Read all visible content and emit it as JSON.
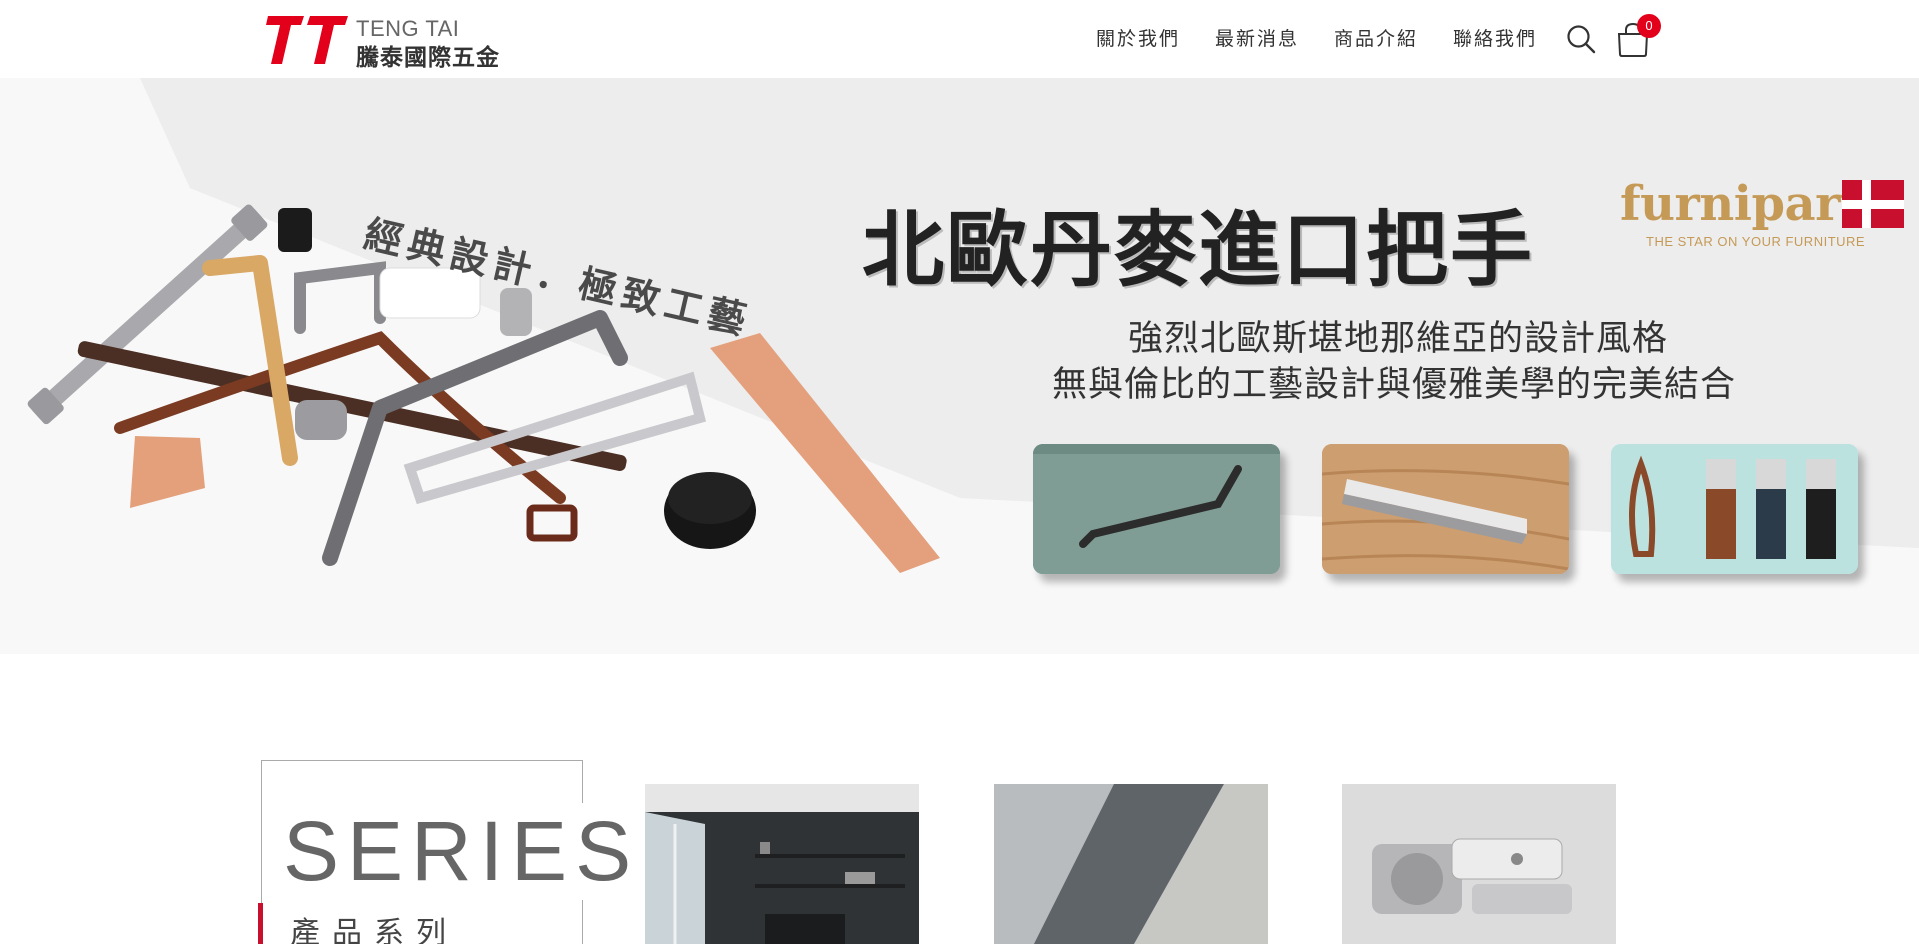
{
  "header": {
    "logo": {
      "mark": "TT",
      "en": "TENG TAI",
      "zh": "騰泰國際五金"
    },
    "nav": [
      {
        "label": "關於我們"
      },
      {
        "label": "最新消息"
      },
      {
        "label": "商品介紹"
      },
      {
        "label": "聯絡我們"
      }
    ],
    "icons": {
      "search": "search-icon",
      "cart": "shopping-bag-icon"
    },
    "cart_count": "0",
    "accent_color": "#e2001a"
  },
  "banner": {
    "slogan": "經典設計．極致工藝",
    "title": "北歐丹麥進口把手",
    "brand": {
      "name": "furnipart",
      "tagline": "THE STAR ON YOUR FURNITURE",
      "color": "#c59a57",
      "flag": "denmark-flag"
    },
    "description": [
      "強烈北歐斯堪地那維亞的設計風格",
      "無與倫比的工藝設計與優雅美學的完美結合"
    ]
  },
  "series": {
    "title_en": "SERIES",
    "title_zh": "產品系列",
    "accent_color": "#c8102e"
  }
}
